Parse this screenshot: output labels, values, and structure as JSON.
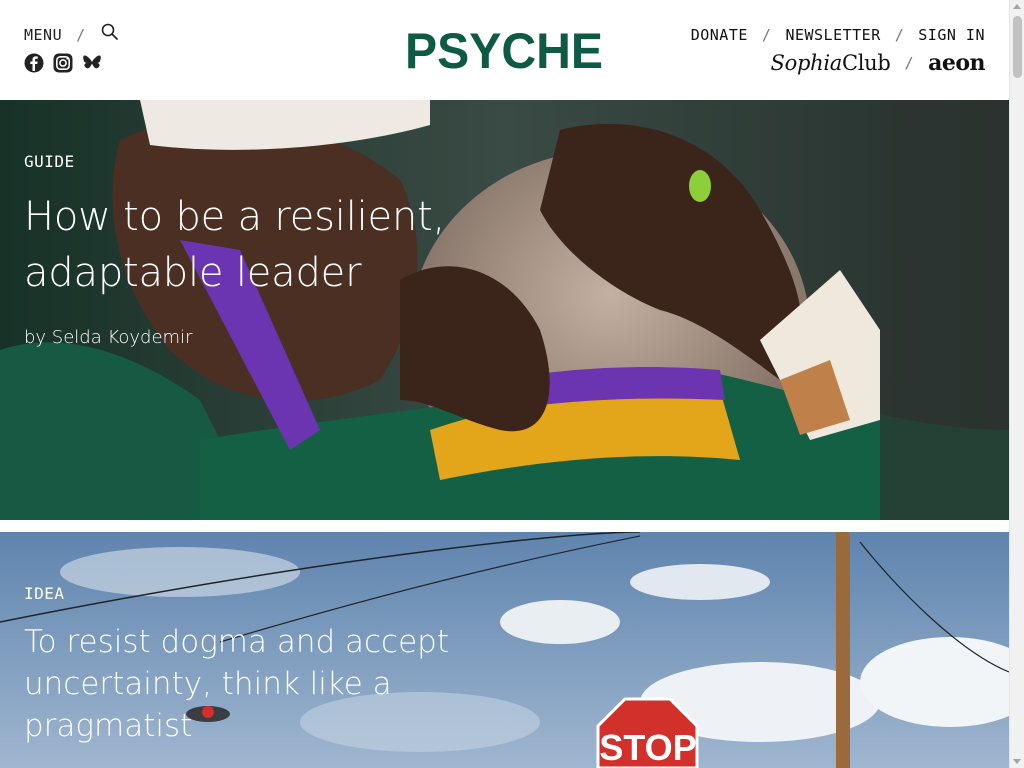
{
  "header": {
    "menu_label": "MENU",
    "separator": "/",
    "logo_text": "PSYCHE",
    "donate_label": "DONATE",
    "newsletter_label": "NEWSLETTER",
    "signin_label": "SIGN IN",
    "sophia_part1": "Sophia",
    "sophia_part2": "Club",
    "aeon_label": "aeon",
    "icons": [
      "search-icon",
      "facebook-icon",
      "instagram-icon",
      "bluesky-icon"
    ],
    "logo_color": "#0e5a44",
    "sophia_color": "#c4494e",
    "aeon_color": "#a3262a"
  },
  "articles": [
    {
      "tag": "GUIDE",
      "title": "How to be a resilient, adaptable leader",
      "byline": "by Selda Koydemir"
    },
    {
      "tag": "IDEA",
      "title": "To resist dogma and accept uncertainty, think like a pragmatist",
      "sign_text": "STOP"
    }
  ]
}
